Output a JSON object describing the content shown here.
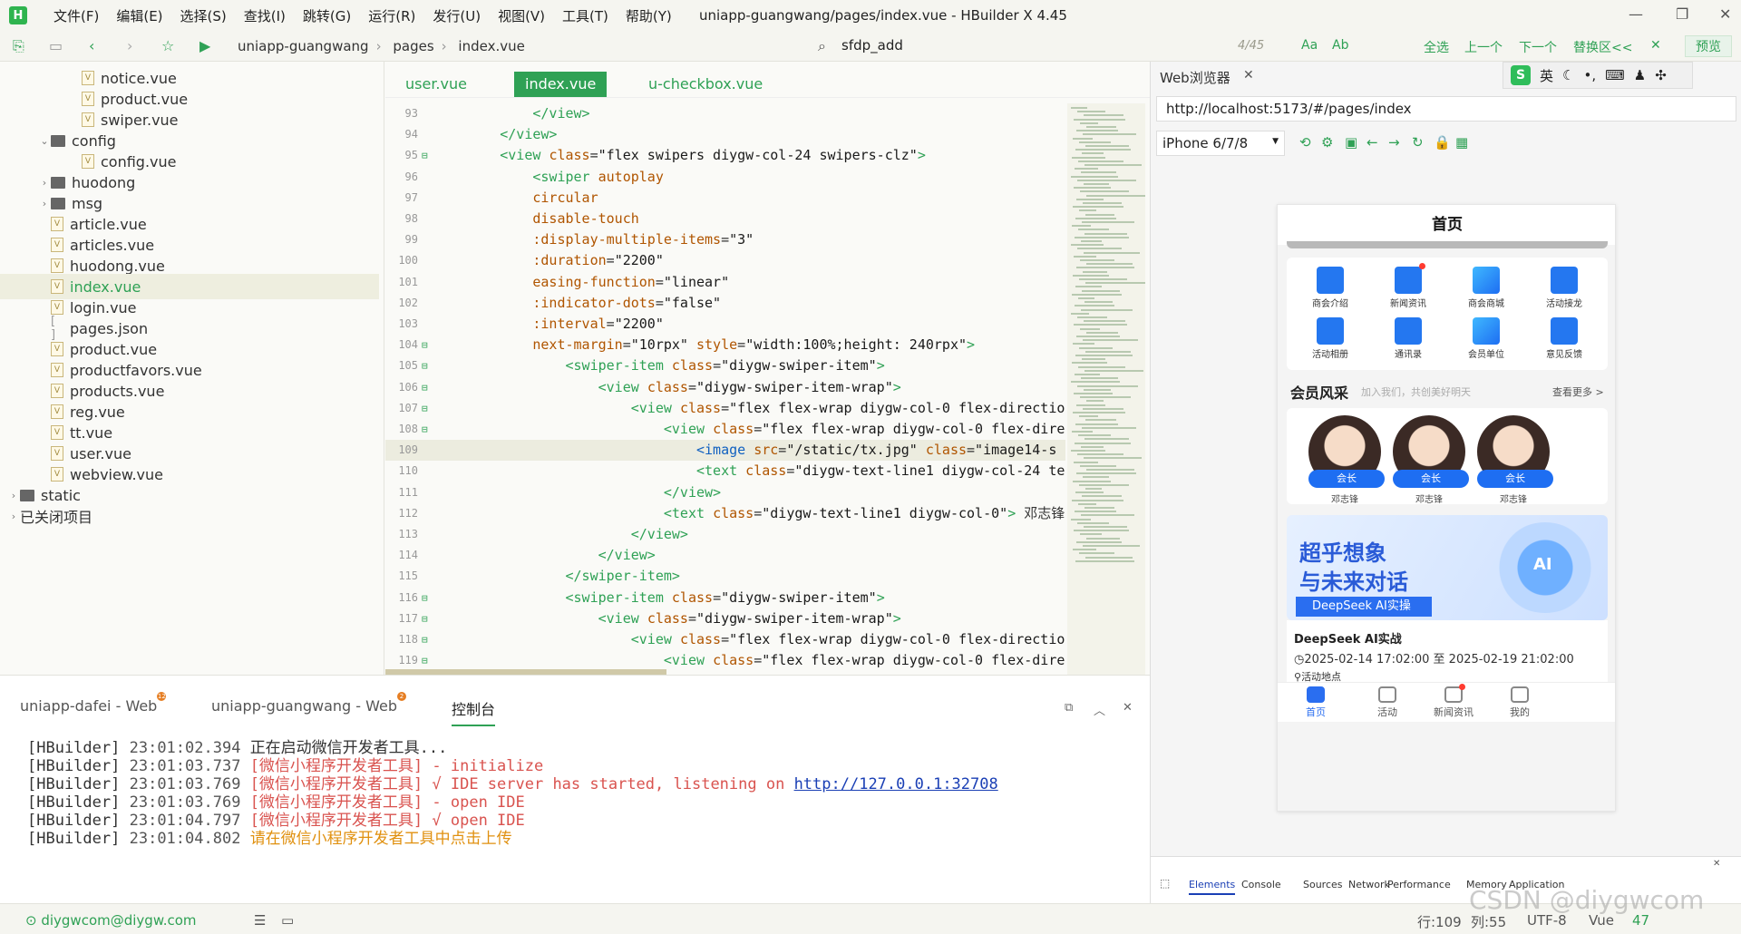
{
  "app": {
    "title": "uniapp-guangwang/pages/index.vue - HBuilder X 4.45",
    "logo": "H",
    "menu": [
      "文件(F)",
      "编辑(E)",
      "选择(S)",
      "查找(I)",
      "跳转(G)",
      "运行(R)",
      "发行(U)",
      "视图(V)",
      "工具(T)",
      "帮助(Y)"
    ]
  },
  "toolbar": {
    "breadcrumb": [
      "uniapp-guangwang",
      "pages",
      "index.vue"
    ],
    "search_value": "sfdp_add",
    "search_count": "4/45",
    "find_buttons": [
      "Aa",
      "Ab",
      "全选",
      "上一个",
      "下一个",
      "替换区<<"
    ],
    "preview": "预览"
  },
  "sidebar": {
    "items": [
      {
        "label": "notice.vue",
        "type": "file",
        "indent": 2
      },
      {
        "label": "product.vue",
        "type": "file",
        "indent": 2
      },
      {
        "label": "swiper.vue",
        "type": "file",
        "indent": 2
      },
      {
        "label": "config",
        "type": "folder-open",
        "indent": 1
      },
      {
        "label": "config.vue",
        "type": "file",
        "indent": 2
      },
      {
        "label": "huodong",
        "type": "folder",
        "indent": 1
      },
      {
        "label": "msg",
        "type": "folder",
        "indent": 1
      },
      {
        "label": "article.vue",
        "type": "file",
        "indent": 1
      },
      {
        "label": "articles.vue",
        "type": "file",
        "indent": 1
      },
      {
        "label": "huodong.vue",
        "type": "file",
        "indent": 1
      },
      {
        "label": "index.vue",
        "type": "file",
        "indent": 1,
        "active": true
      },
      {
        "label": "login.vue",
        "type": "file",
        "indent": 1
      },
      {
        "label": "pages.json",
        "type": "json",
        "indent": 1
      },
      {
        "label": "product.vue",
        "type": "file",
        "indent": 1
      },
      {
        "label": "productfavors.vue",
        "type": "file",
        "indent": 1
      },
      {
        "label": "products.vue",
        "type": "file",
        "indent": 1
      },
      {
        "label": "reg.vue",
        "type": "file",
        "indent": 1
      },
      {
        "label": "tt.vue",
        "type": "file",
        "indent": 1
      },
      {
        "label": "user.vue",
        "type": "file",
        "indent": 1
      },
      {
        "label": "webview.vue",
        "type": "file",
        "indent": 1
      },
      {
        "label": "static",
        "type": "folder",
        "indent": 0
      },
      {
        "label": "已关闭项目",
        "type": "section",
        "indent": 0
      }
    ]
  },
  "editor": {
    "tabs": [
      "user.vue",
      "index.vue",
      "u-checkbox.vue"
    ],
    "active_tab": 1,
    "lines": [
      {
        "n": "93",
        "html": "            <span class='t-tag'>&lt;/view&gt;</span>"
      },
      {
        "n": "94",
        "html": "        <span class='t-tag'>&lt;/view&gt;</span>"
      },
      {
        "n": "95",
        "fold": true,
        "html": "        <span class='t-tag'>&lt;view</span> <span class='t-attr'>class</span>=<span class='t-str'>\"flex swipers diygw-col-24 swipers-clz\"</span><span class='t-tag'>&gt;</span>"
      },
      {
        "n": "96",
        "html": "            <span class='t-tag'>&lt;swiper</span> <span class='t-attr'>autoplay</span>"
      },
      {
        "n": "97",
        "html": "            <span class='t-attr'>circular</span>"
      },
      {
        "n": "98",
        "html": "            <span class='t-attr'>disable-touch</span>"
      },
      {
        "n": "99",
        "html": "            <span class='t-attr'>:display-multiple-items</span>=<span class='t-str'>\"3\"</span>"
      },
      {
        "n": "100",
        "html": "            <span class='t-attr'>:duration</span>=<span class='t-str'>\"2200\"</span>"
      },
      {
        "n": "101",
        "html": "            <span class='t-attr'>easing-function</span>=<span class='t-str'>\"linear\"</span>"
      },
      {
        "n": "102",
        "html": "            <span class='t-attr'>:indicator-dots</span>=<span class='t-str'>\"false\"</span>"
      },
      {
        "n": "103",
        "html": "            <span class='t-attr'>:interval</span>=<span class='t-str'>\"2200\"</span>"
      },
      {
        "n": "104",
        "fold": true,
        "html": "            <span class='t-attr'>next-margin</span>=<span class='t-str'>\"10rpx\"</span> <span class='t-attr'>style</span>=<span class='t-str'>\"width:100%;height: 240rpx\"</span><span class='t-tag'>&gt;</span>"
      },
      {
        "n": "105",
        "fold": true,
        "html": "                <span class='t-tag'>&lt;swiper-item</span> <span class='t-attr'>class</span>=<span class='t-str'>\"diygw-swiper-item\"</span><span class='t-tag'>&gt;</span>"
      },
      {
        "n": "106",
        "fold": true,
        "html": "                    <span class='t-tag'>&lt;view</span> <span class='t-attr'>class</span>=<span class='t-str'>\"diygw-swiper-item-wrap\"</span><span class='t-tag'>&gt;</span>"
      },
      {
        "n": "107",
        "fold": true,
        "html": "                        <span class='t-tag'>&lt;view</span> <span class='t-attr'>class</span>=<span class='t-str'>\"flex flex-wrap diygw-col-0 flex-directio</span>"
      },
      {
        "n": "108",
        "fold": true,
        "html": "                            <span class='t-tag'>&lt;view</span> <span class='t-attr'>class</span>=<span class='t-str'>\"flex flex-wrap diygw-col-0 flex-dire</span>"
      },
      {
        "n": "109",
        "hl": true,
        "html": "                                <span class='t-blue'>&lt;image</span> <span class='t-attr'>src</span>=<span class='t-str'>\"/static/tx.jpg\"</span> <span class='t-attr'>class</span>=<span class='t-str'>\"image14-s</span>"
      },
      {
        "n": "110",
        "html": "                                <span class='t-tag'>&lt;text</span> <span class='t-attr'>class</span>=<span class='t-str'>\"diygw-text-line1 diygw-col-24 te</span>"
      },
      {
        "n": "111",
        "html": "                            <span class='t-tag'>&lt;/view&gt;</span>"
      },
      {
        "n": "112",
        "html": "                            <span class='t-tag'>&lt;text</span> <span class='t-attr'>class</span>=<span class='t-str'>\"diygw-text-line1 diygw-col-0\"</span><span class='t-tag'>&gt;</span> 邓志锋"
      },
      {
        "n": "113",
        "html": "                        <span class='t-tag'>&lt;/view&gt;</span>"
      },
      {
        "n": "114",
        "html": "                    <span class='t-tag'>&lt;/view&gt;</span>"
      },
      {
        "n": "115",
        "html": "                <span class='t-tag'>&lt;/swiper-item&gt;</span>"
      },
      {
        "n": "116",
        "fold": true,
        "html": "                <span class='t-tag'>&lt;swiper-item</span> <span class='t-attr'>class</span>=<span class='t-str'>\"diygw-swiper-item\"</span><span class='t-tag'>&gt;</span>"
      },
      {
        "n": "117",
        "fold": true,
        "html": "                    <span class='t-tag'>&lt;view</span> <span class='t-attr'>class</span>=<span class='t-str'>\"diygw-swiper-item-wrap\"</span><span class='t-tag'>&gt;</span>"
      },
      {
        "n": "118",
        "fold": true,
        "html": "                        <span class='t-tag'>&lt;view</span> <span class='t-attr'>class</span>=<span class='t-str'>\"flex flex-wrap diygw-col-0 flex-directio</span>"
      },
      {
        "n": "119",
        "fold": true,
        "html": "                            <span class='t-tag'>&lt;view</span> <span class='t-attr'>class</span>=<span class='t-str'>\"flex flex-wrap diygw-col-0 flex-dire</span>"
      }
    ]
  },
  "bottom_panel": {
    "tabs": [
      {
        "label": "uniapp-dafei - Web",
        "badge": "12"
      },
      {
        "label": "uniapp-guangwang - Web",
        "badge": "2"
      },
      {
        "label": "控制台",
        "active": true
      }
    ],
    "console": [
      {
        "tag": "[HBuilder]",
        "time": "23:01:02.394",
        "msg": "正在启动微信开发者工具...",
        "color": "c-gray"
      },
      {
        "tag": "[HBuilder]",
        "time": "23:01:03.737",
        "msg": "[微信小程序开发者工具] - initialize",
        "color": "c-red"
      },
      {
        "tag": "[HBuilder]",
        "time": "23:01:03.769",
        "msg": "[微信小程序开发者工具] √ IDE server has started, listening on ",
        "link": "http://127.0.0.1:32708",
        "color": "c-red"
      },
      {
        "tag": "[HBuilder]",
        "time": "23:01:03.769",
        "msg": "[微信小程序开发者工具] - open IDE",
        "color": "c-red"
      },
      {
        "tag": "[HBuilder]",
        "time": "23:01:04.797",
        "msg": "[微信小程序开发者工具] √ open IDE",
        "color": "c-red"
      },
      {
        "tag": "[HBuilder]",
        "time": "23:01:04.802",
        "msg": "请在微信小程序开发者工具中点击上传",
        "color": "c-orange"
      }
    ]
  },
  "statusbar": {
    "user": "diygwcom@diygw.com",
    "line": "行:109",
    "col": "列:55",
    "encoding": "UTF-8",
    "lang": "Vue",
    "count": "47"
  },
  "browser": {
    "title": "Web浏览器",
    "url": "http://localhost:5173/#/pages/index",
    "device": "iPhone 6/7/8",
    "ime": [
      "英"
    ],
    "phone": {
      "title": "首页",
      "grid": [
        {
          "label": "商会介绍"
        },
        {
          "label": "新闻资讯",
          "dot": true
        },
        {
          "label": "商会商城"
        },
        {
          "label": "活动接龙"
        },
        {
          "label": "活动相册"
        },
        {
          "label": "通讯录"
        },
        {
          "label": "会员单位"
        },
        {
          "label": "意见反馈"
        }
      ],
      "member_title": "会员风采",
      "member_sub": "加入我们，共创美好明天",
      "member_more": "查看更多 >",
      "members": [
        {
          "role": "会长",
          "name": "邓志锋"
        },
        {
          "role": "会长",
          "name": "邓志锋"
        },
        {
          "role": "会长",
          "name": "邓志锋"
        }
      ],
      "banner_line1": "超乎想象",
      "banner_line2": "与未来对话",
      "banner_tag": "DeepSeek AI实操",
      "banner_ai": "AI",
      "event_title": "DeepSeek AI实战",
      "event_time": "2025-02-14 17:02:00 至 2025-02-19 21:02:00",
      "event_loc": "活动地点",
      "tabbar": [
        {
          "label": "首页",
          "active": true
        },
        {
          "label": "活动"
        },
        {
          "label": "新闻资讯",
          "dot": true
        },
        {
          "label": "我的"
        }
      ]
    },
    "devtools": [
      "Elements",
      "Console",
      "Sources",
      "Network",
      "Performance",
      "Memory",
      "Application"
    ]
  },
  "watermark": "CSDN @diygwcom"
}
